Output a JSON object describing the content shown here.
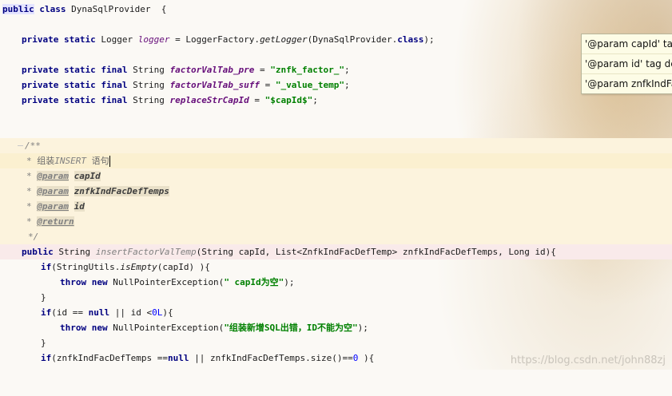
{
  "editor": {
    "class_decl": {
      "kw": "public",
      "kw2": "class",
      "name": "DynaSqlProvider",
      "brace": "{"
    },
    "logger_line": {
      "kw": "private static",
      "type": "Logger",
      "field": "logger",
      "rest1": " = LoggerFactory.",
      "call": "getLogger",
      "rest2": "(DynaSqlProvider.",
      "kw_class": "class",
      "rest3": ");"
    },
    "const_lines": [
      {
        "kw": "private static final",
        "type": "String",
        "field": "factorValTab_pre",
        "eq": " = ",
        "value": "\"znfk_factor_\"",
        "end": ";"
      },
      {
        "kw": "private static final",
        "type": "String",
        "field": "factorValTab_suff",
        "eq": " = ",
        "value": "\"_value_temp\"",
        "end": ";"
      },
      {
        "kw": "private static final",
        "type": "String",
        "field": "replaceStrCapId",
        "eq": " = ",
        "value": "\"$capId$\"",
        "end": ";"
      }
    ],
    "doc": {
      "open": "/**",
      "summary_star": "* ",
      "summary_a": "组装",
      "summary_b": "INSERT",
      "summary_c": " 语句",
      "params": [
        {
          "tag": "@param",
          "name": "capId"
        },
        {
          "tag": "@param",
          "name": "znfkIndFacDefTemps"
        },
        {
          "tag": "@param",
          "name": "id"
        }
      ],
      "return_tag": "@return",
      "close": "*/"
    },
    "method_sig": {
      "kw": "public",
      "type": "String",
      "name": "insertFactorValTemp",
      "params": "(String capId, List<ZnfkIndFacDefTemp> znfkIndFacDefTemps, Long id){"
    },
    "body": {
      "if1_kw": "if",
      "if1_a": "(StringUtils.",
      "if1_call": "isEmpty",
      "if1_b": "(capId) ){",
      "throw1_kw": "throw new",
      "throw1_a": " NullPointerException(",
      "throw1_str": "\" capId为空\"",
      "throw1_b": ");",
      "close1": "}",
      "if2_kw": "if",
      "if2_a": "(id == ",
      "if2_null": "null",
      "if2_b": " || id <",
      "if2_num": "0L",
      "if2_c": "){",
      "throw2_kw": "throw new",
      "throw2_a": " NullPointerException(",
      "throw2_str": "\"组装新增SQL出错，ID不能为空\"",
      "throw2_b": ");",
      "close2": "}",
      "if3_kw": "if",
      "if3_a": "(znfkIndFacDefTemps ==",
      "if3_null": "null",
      "if3_b": " || znfkIndFacDefTemps.size()==",
      "if3_num": "0",
      "if3_c": " ){"
    }
  },
  "popup": {
    "items": [
      "'@param capId' tag",
      "'@param id' tag de",
      "'@param znfkIndFa"
    ]
  },
  "watermark": "https://blog.csdn.net/john88zj"
}
